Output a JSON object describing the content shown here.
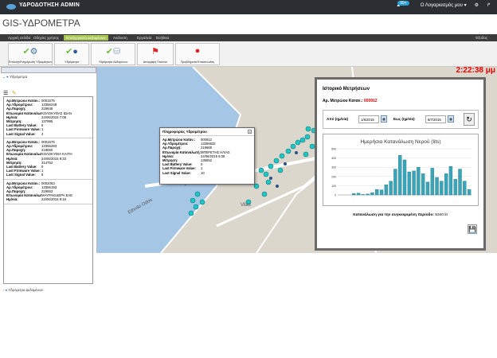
{
  "topbar": {
    "app_title": "ΥΔΡΟΔΟΤΗΣΗ  ADMIN",
    "notification_count": "99+",
    "account_label": "Ο Λογαριασμός μου ▾"
  },
  "page_title": "GIS-ΥΔΡΟΜΕΤΡΑ",
  "menu": {
    "items": [
      "Αρχική σελίδα",
      "Οδηγίες χρήσης",
      "Επεξεργασία",
      "Ανάλυση",
      "Εργαλεία",
      "Βοήθεια"
    ],
    "active_label": "Επεξεργασία Δεδομένων",
    "right_label": "Έξοδος"
  },
  "ribbon": {
    "buttons": [
      {
        "label": "Επιλογή/Ενημέρωση Υδρομέτρων",
        "icon": "check-gear-icon"
      },
      {
        "label": "Υδρόμετρα",
        "icon": "person-icon"
      },
      {
        "label": "Υδρόμετρα Δεδομένων",
        "icon": "database-icon"
      },
      {
        "label": "Απόρριψη Πολιτών",
        "icon": "flag-icon"
      },
      {
        "label": "Προβλήματα Επικοινωνίας",
        "icon": "alert-icon"
      }
    ]
  },
  "left_panel": {
    "tree_root": "Υδρόμετρα",
    "records": [
      {
        "meter_no": "0001576",
        "hydro_id": "13356248",
        "area_code": "219648",
        "consumer": "ΚΟΛΟΚΥΘΑΣ ΙΩΑΝ",
        "date": "24/06/2015 7:08",
        "reading": "137995",
        "battery": "6",
        "firmware": "1",
        "signal": "4"
      },
      {
        "meter_no": "0001575",
        "hydro_id": "13356283",
        "area_code": "219650",
        "consumer": "ΚΟΛΟΚΥΘΙΑ ΚΑΙΤΗ",
        "date": "24/06/2015 9:33",
        "reading": "314752",
        "battery": "6",
        "firmware": "1",
        "signal": "8"
      },
      {
        "meter_no": "0002063",
        "hydro_id": "13356193",
        "area_code": "219652",
        "consumer": "ΜΑΥΡΑΚΙΔΕΡΑ ΕΛΕ",
        "date": "24/06/2015 9:16",
        "reading": "",
        "battery": "",
        "firmware": "",
        "signal": ""
      }
    ],
    "labels": {
      "meter_no": "Αρ.Μετρώου Καταν.:",
      "hydro_id": "Αρ.Υδρομέτρου:",
      "area_code": "Αρ.Παροχή:",
      "consumer": "Επωνυμία Καταναλωτή:",
      "date": "Ημ/νία:",
      "reading": "Μέτρηση:",
      "battery": "Last Battery Value:",
      "firmware": "Last Firmware Value:",
      "signal": "Last Signal Value:"
    },
    "footer_label": "Υδρόμετρα Δεδομένων"
  },
  "clock": "2:22:38 μμ",
  "map": {
    "street_labels": [
      "Ethniki Odos",
      "Sokrati",
      "Vilas"
    ]
  },
  "popup": {
    "title": "Πληροφορίες Υδρομέτρου",
    "rows": [
      {
        "k": "Αρ.Μετρώου Καταν.:",
        "v": "000912"
      },
      {
        "k": "Αρ.Υδρομέτρου:",
        "v": "13356632"
      },
      {
        "k": "Αρ.Παροχή:",
        "v": "219669"
      },
      {
        "k": "Επωνυμία Καταναλωτή:",
        "v": "ΜΠΕΡΕΤΗΣ ΗΛΙΑΣ"
      },
      {
        "k": "Ημ/νία:",
        "v": "24/06/2015 9:38"
      },
      {
        "k": "Μέτρηση:",
        "v": "135652"
      },
      {
        "k": "Last Battery Value:",
        "v": "0"
      },
      {
        "k": "Last Firmware Value:",
        "v": "1"
      },
      {
        "k": "Last Signal Value:",
        "v": "10"
      }
    ]
  },
  "history": {
    "title": "Ιστορικό Μετρήσεων",
    "meter_label": "Αρ. Μετρώου Καταν.:",
    "meter_value": "000912",
    "from_label": "Από (ημ/νία)",
    "from_value": "1/6/2015",
    "to_label": "Εως (ημ/νία)",
    "to_value": "8/7/2015",
    "total_label": "Κατανάλωση για την συγκεκριμένη περίοδο:",
    "total_value": "5340 lit"
  },
  "chart_data": {
    "type": "bar",
    "title": "Ημερήσια Κατανάλωση Νερού (lits)",
    "ylim": [
      0,
      500
    ],
    "yticks": [
      0,
      100,
      200,
      300,
      400,
      500
    ],
    "values": [
      0,
      0,
      0,
      15,
      20,
      5,
      10,
      25,
      60,
      55,
      110,
      150,
      280,
      430,
      380,
      250,
      260,
      300,
      230,
      140,
      290,
      190,
      150,
      230,
      310,
      170,
      280,
      150,
      60
    ],
    "bar_color": "#3aa4b8"
  }
}
